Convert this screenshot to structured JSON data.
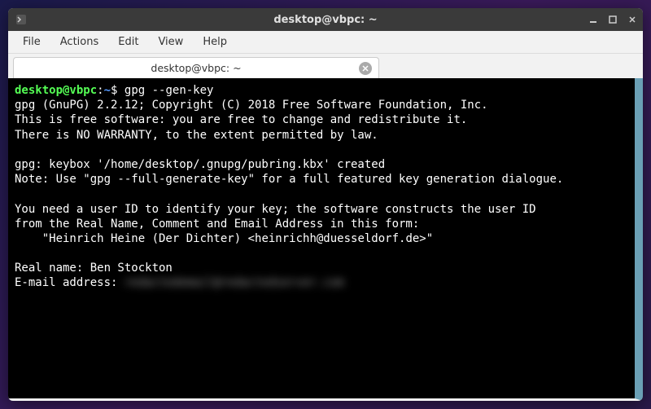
{
  "title": "desktop@vbpc: ~",
  "menu": [
    "File",
    "Actions",
    "Edit",
    "View",
    "Help"
  ],
  "tab": {
    "label": "desktop@vbpc: ~"
  },
  "prompt": {
    "user": "desktop@vbpc",
    "sep1": ":",
    "path": "~",
    "sep2": "$ "
  },
  "command": "gpg --gen-key",
  "output": {
    "l1": "gpg (GnuPG) 2.2.12; Copyright (C) 2018 Free Software Foundation, Inc.",
    "l2": "This is free software: you are free to change and redistribute it.",
    "l3": "There is NO WARRANTY, to the extent permitted by law.",
    "l4": "",
    "l5": "gpg: keybox '/home/desktop/.gnupg/pubring.kbx' created",
    "l6": "Note: Use \"gpg --full-generate-key\" for a full featured key generation dialogue.",
    "l7": "",
    "l8": "You need a user ID to identify your key; the software constructs the user ID",
    "l9": "from the Real Name, Comment and Email Address in this form:",
    "l10": "    \"Heinrich Heine (Der Dichter) <heinrichh@duesseldorf.de>\"",
    "l11": "",
    "rn_label": "Real name: ",
    "rn_value": "Ben Stockton",
    "em_label": "E-mail address: ",
    "em_value": "redactedemail@redactedserver.com"
  }
}
